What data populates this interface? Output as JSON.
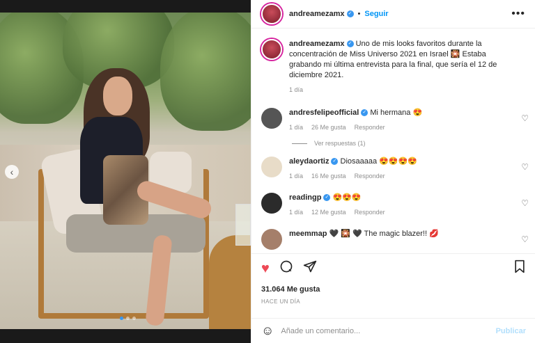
{
  "post": {
    "username": "andreamezamx",
    "follow_label": "Seguir",
    "more_icon": "•••",
    "caption": "Uno de mis looks favoritos durante la concentración de Miss Universo 2021 en Israel 🎇 Estaba grabando mi última entrevista para la final, que sería el 12 de diciembre 2021.",
    "caption_time": "1 día",
    "likes": "31.064 Me gusta",
    "posted": "HACE UN DÍA"
  },
  "comments": [
    {
      "user": "andresfelipeofficial",
      "text": "Mi hermana 😍",
      "time": "1 día",
      "likes": "26 Me gusta",
      "reply": "Responder",
      "view_replies": "Ver respuestas (1)"
    },
    {
      "user": "aleydaortiz",
      "text": "Diosaaaaa 😍😍😍😍",
      "time": "1 día",
      "likes": "16 Me gusta",
      "reply": "Responder"
    },
    {
      "user": "readingp",
      "text": "😍😍😍",
      "time": "1 día",
      "likes": "12 Me gusta",
      "reply": "Responder"
    },
    {
      "user": "meemmap",
      "text": "🖤 🎇 🖤 The magic blazer!! 💋"
    }
  ],
  "composer": {
    "placeholder": "Añade un comentario...",
    "publish": "Publicar"
  },
  "colors": {
    "accent": "#0095f6",
    "like_red": "#ed4956",
    "verified": "#3897f0"
  }
}
